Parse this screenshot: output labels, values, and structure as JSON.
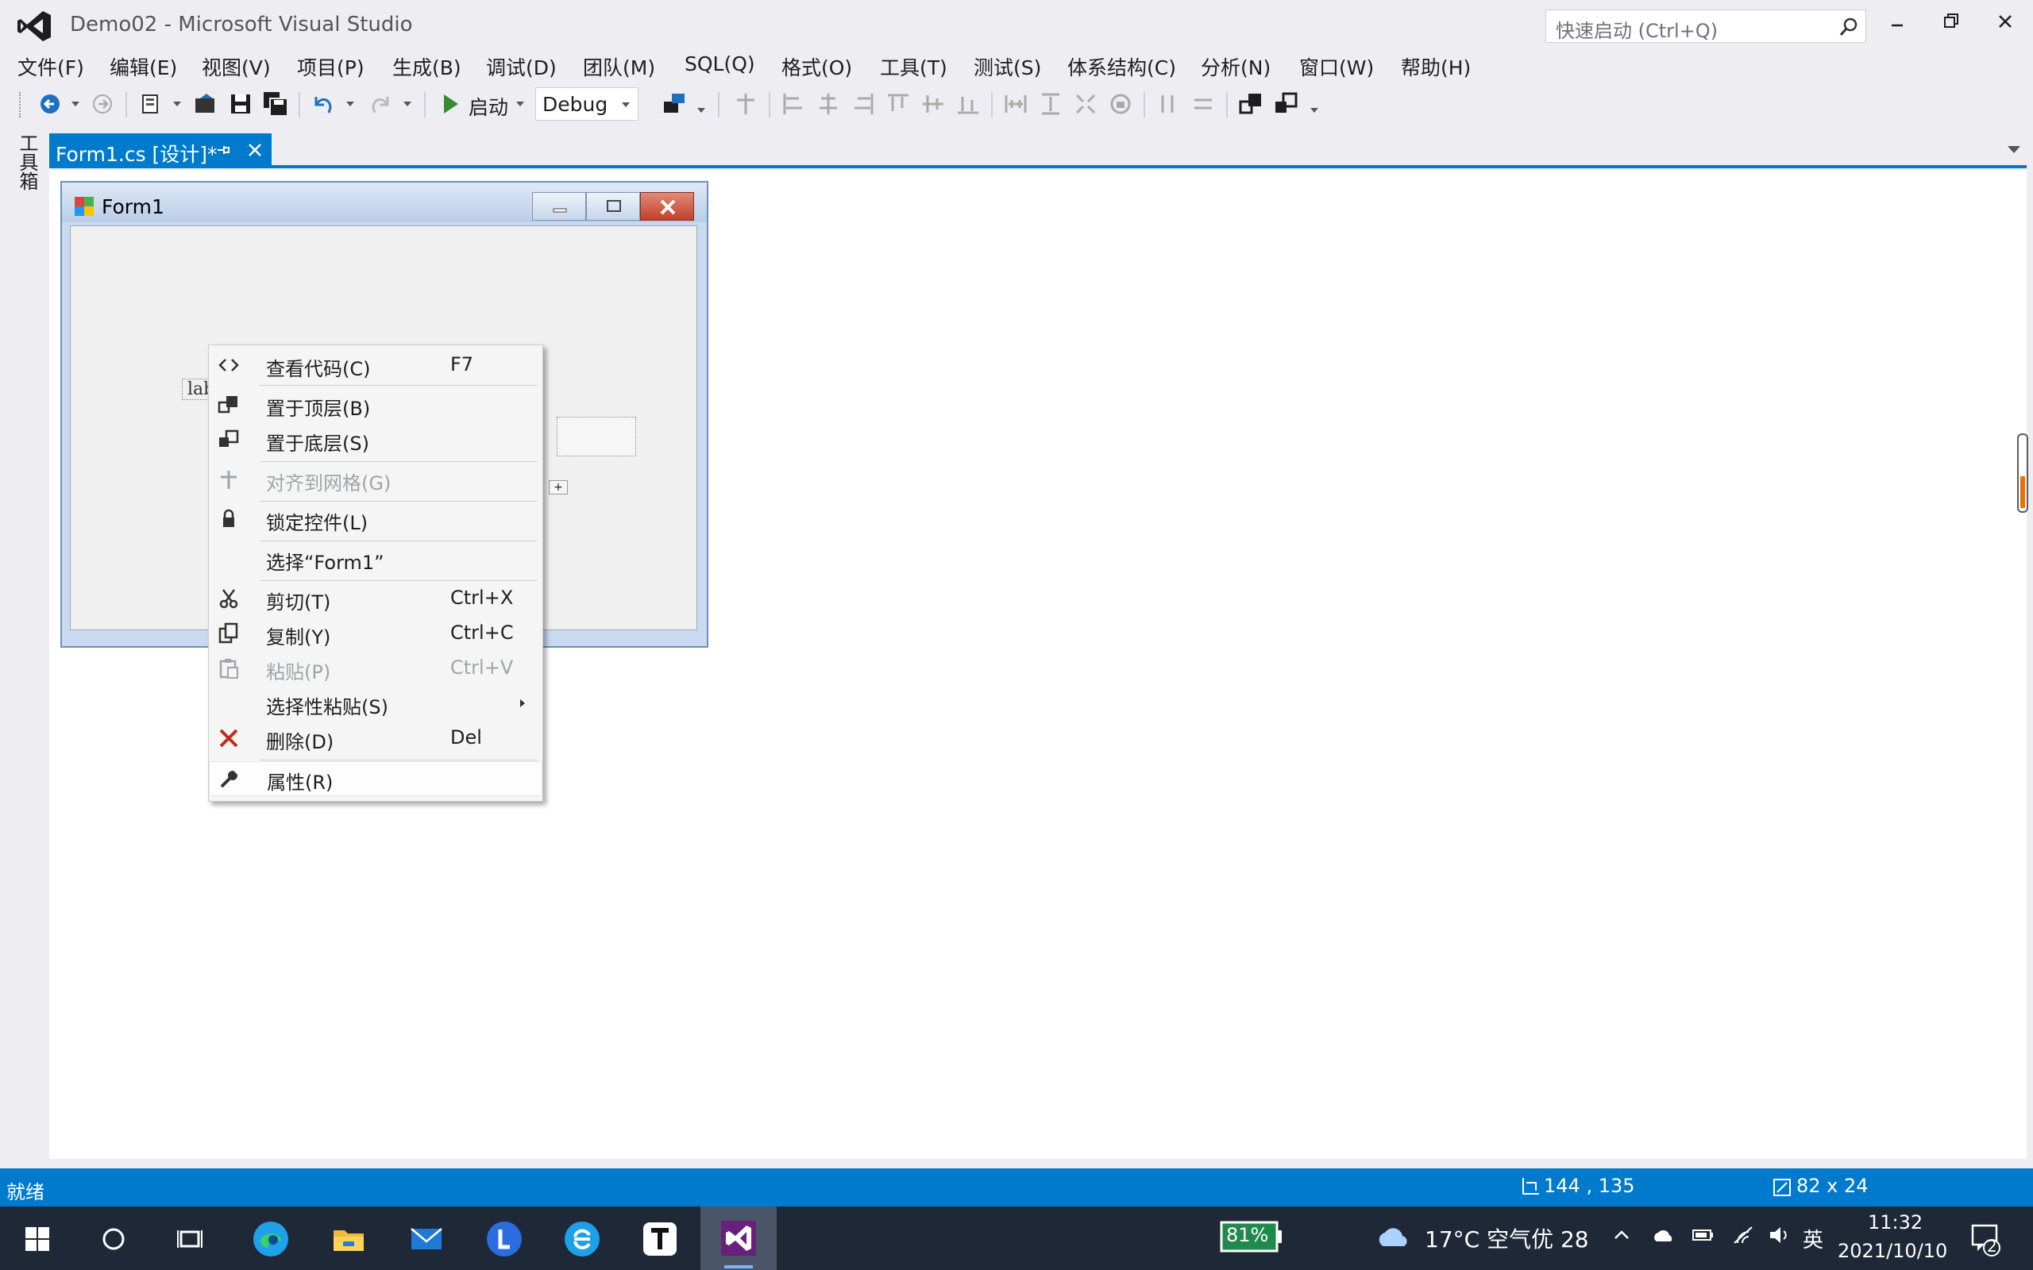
{
  "window": {
    "title": "Demo02 - Microsoft Visual Studio",
    "quick_launch_placeholder": "快速启动 (Ctrl+Q)"
  },
  "menu": [
    "文件(F)",
    "编辑(E)",
    "视图(V)",
    "项目(P)",
    "生成(B)",
    "调试(D)",
    "团队(M)",
    "SQL(Q)",
    "格式(O)",
    "工具(T)",
    "测试(S)",
    "体系结构(C)",
    "分析(N)",
    "窗口(W)",
    "帮助(H)"
  ],
  "toolbar": {
    "start_label": "启动",
    "configuration": "Debug"
  },
  "toolbox_label": "工具箱",
  "document_tab": {
    "label": "Form1.cs [设计]*"
  },
  "designer": {
    "form_title": "Form1",
    "label_text": "label1"
  },
  "context_menu": {
    "items": [
      {
        "label": "查看代码(C)",
        "shortcut": "F7",
        "icon": "code-icon"
      },
      {
        "label": "置于顶层(B)",
        "shortcut": "",
        "icon": "bring-to-front-icon"
      },
      {
        "label": "置于底层(S)",
        "shortcut": "",
        "icon": "send-to-back-icon"
      },
      {
        "label": "对齐到网格(G)",
        "shortcut": "",
        "icon": "align-grid-icon"
      },
      {
        "label": "锁定控件(L)",
        "shortcut": "",
        "icon": "lock-icon"
      },
      {
        "label": "选择“Form1”",
        "shortcut": "",
        "icon": ""
      },
      {
        "label": "剪切(T)",
        "shortcut": "Ctrl+X",
        "icon": "cut-icon"
      },
      {
        "label": "复制(Y)",
        "shortcut": "Ctrl+C",
        "icon": "copy-icon"
      },
      {
        "label": "粘贴(P)",
        "shortcut": "Ctrl+V",
        "icon": "paste-icon"
      },
      {
        "label": "选择性粘贴(S)",
        "shortcut": "",
        "icon": ""
      },
      {
        "label": "删除(D)",
        "shortcut": "Del",
        "icon": "delete-icon"
      },
      {
        "label": "属性(R)",
        "shortcut": "",
        "icon": "wrench-icon"
      }
    ]
  },
  "status_bar": {
    "status": "就绪",
    "position": "144 , 135",
    "size": "82 x 24"
  },
  "taskbar": {
    "battery": "81%",
    "weather": "17°C 空气优 28",
    "ime": "英",
    "time": "11:32",
    "date": "2021/10/10",
    "notifications": "2"
  },
  "colors": {
    "accent": "#007acc",
    "vs_purple": "#68217a",
    "taskbar": "#1f2836",
    "delete_red": "#c42b1c"
  }
}
